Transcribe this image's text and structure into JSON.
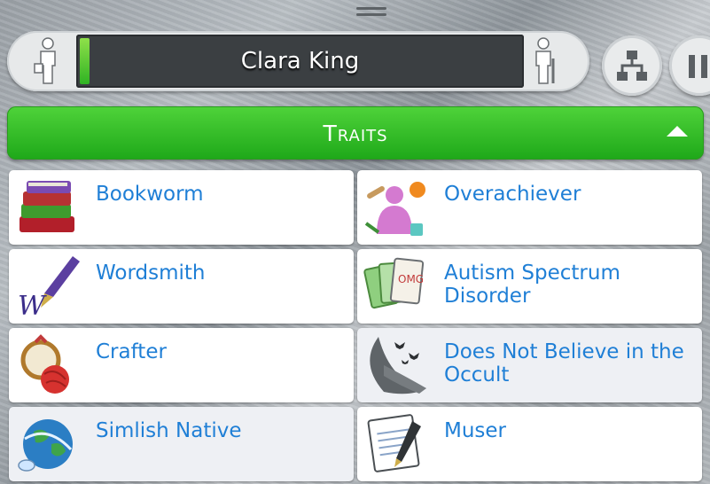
{
  "sim": {
    "name": "Clara King"
  },
  "section": {
    "title": "Traits"
  },
  "traits": [
    {
      "label": "Bookworm",
      "icon": "books-icon"
    },
    {
      "label": "Overachiever",
      "icon": "overachiever-icon"
    },
    {
      "label": "Wordsmith",
      "icon": "fountain-pen-icon"
    },
    {
      "label": "Autism Spectrum Disorder",
      "icon": "cards-icon"
    },
    {
      "label": "Crafter",
      "icon": "yarn-icon"
    },
    {
      "label": "Does Not Believe in the Occult",
      "icon": "moon-bats-icon"
    },
    {
      "label": "Simlish Native",
      "icon": "globe-icon"
    },
    {
      "label": "Muser",
      "icon": "notebook-icon"
    }
  ],
  "colors": {
    "accent_green": "#1ea819",
    "trait_text": "#1f7fd6"
  }
}
